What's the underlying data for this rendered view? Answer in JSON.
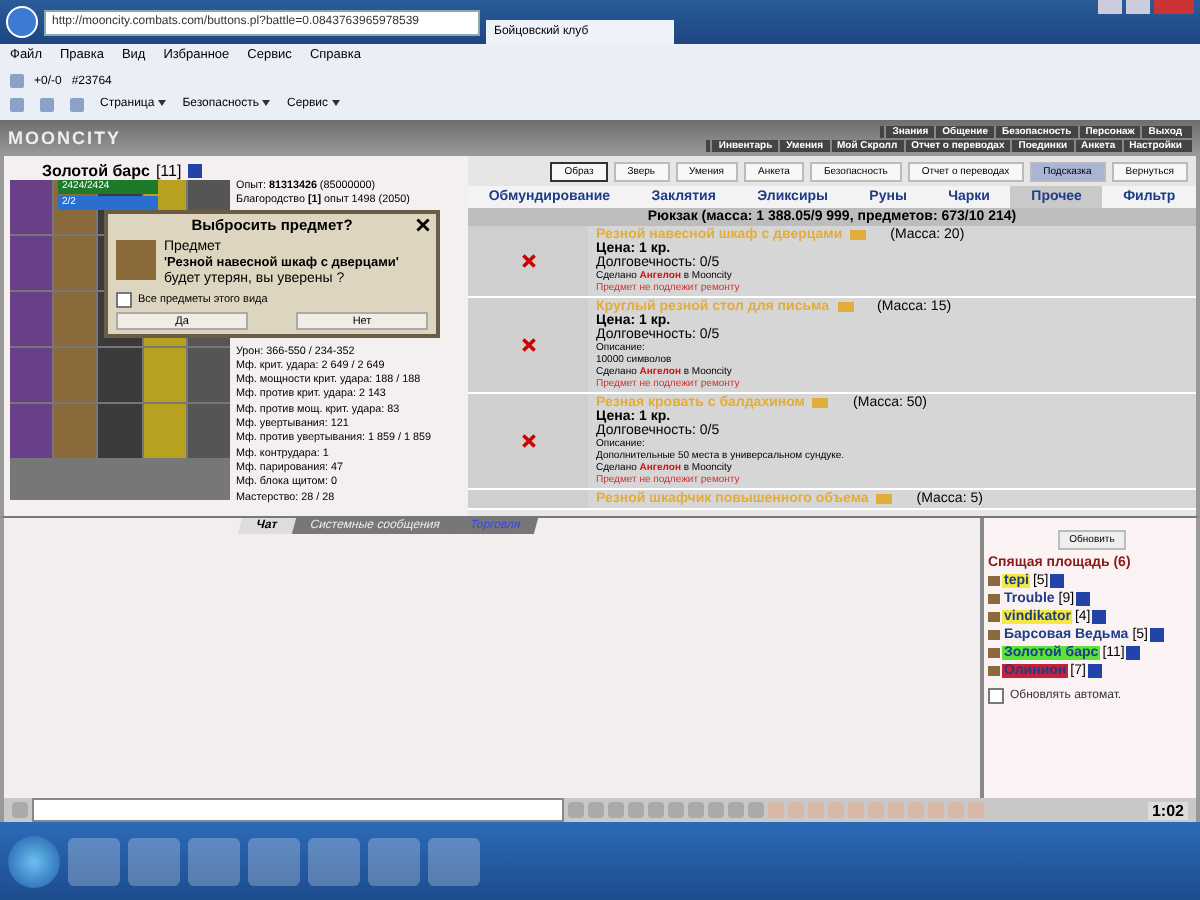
{
  "browser": {
    "url": "http://mooncity.combats.com/buttons.pl?battle=0.0843763965978539",
    "tab_title": "Бойцовский клуб",
    "menu": [
      "Файл",
      "Правка",
      "Вид",
      "Избранное",
      "Сервис",
      "Справка"
    ],
    "favorites": [
      "+0/-0",
      "#23764"
    ],
    "commands": [
      "Страница",
      "Безопасность",
      "Сервис"
    ]
  },
  "game": {
    "logo": "MOONCITY",
    "top_links": [
      "Знания",
      "Общение",
      "Безопасность",
      "Персонаж",
      "Выход"
    ],
    "sub_links": [
      "Инвентарь",
      "Умения",
      "Мой Скролл",
      "Отчет о переводах",
      "Поединки",
      "Анкета",
      "Настройки"
    ]
  },
  "character": {
    "name": "Золотой барс",
    "level": "[11]",
    "hp": {
      "text": "2424/2424",
      "level": 1
    },
    "mana": {
      "text": "2/2",
      "level": 1
    },
    "stats": [
      "Опыт: **81313426** (85000000)",
      "Благородство **[1]** опыт 1498 (2050)"
    ],
    "stats_lower": [
      "Урон: 366-550 / 234-352",
      "Мф. крит. удара: 2 649 / 2 649",
      "Мф. мощности крит. удара: 188 / 188",
      "Мф. против крит. удара: 2 143",
      "Мф. против мощ. крит. удара: 83",
      "Мф. увертывания: 121",
      "Мф. против увертывания: 1 859 / 1 859",
      "Мф. контрудара: 1",
      "Мф. парирования: 47",
      "Мф. блока щитом: 0",
      "Мастерство: 28 / 28"
    ]
  },
  "dialog": {
    "title": "Выбросить предмет?",
    "line_1": "Предмет",
    "item": "'Резной навесной шкаф с дверцами'",
    "line_2": "будет утерян, вы уверены ?",
    "all_of_kind": {
      "label": "Все предметы этого вида",
      "checked": false
    },
    "buttons": [
      "Да",
      "Нет"
    ]
  },
  "buttons": [
    {
      "label": "Образ",
      "highlighted": false,
      "framed": true
    },
    {
      "label": "Зверь",
      "highlighted": false,
      "framed": false
    },
    {
      "label": "Умения",
      "highlighted": false,
      "framed": false
    },
    {
      "label": "Анкета",
      "highlighted": false,
      "framed": false
    },
    {
      "label": "Безопасность",
      "highlighted": false,
      "framed": false
    },
    {
      "label": "Отчет о переводах",
      "highlighted": false,
      "framed": false
    },
    {
      "label": "Подсказка",
      "highlighted": true,
      "framed": false
    },
    {
      "label": "Вернуться",
      "highlighted": false,
      "framed": false
    }
  ],
  "tabs": [
    {
      "label": "Обмундирование",
      "selected": false
    },
    {
      "label": "Заклятия",
      "selected": false
    },
    {
      "label": "Эликсиры",
      "selected": false
    },
    {
      "label": "Руны",
      "selected": false
    },
    {
      "label": "Чарки",
      "selected": false
    },
    {
      "label": "Прочее",
      "selected": true
    },
    {
      "label": "Фильтр",
      "selected": false
    }
  ],
  "backpack_title": "Рюкзак (масса: 1 388.05/9 999, предметов: 673/10 214)",
  "items": [
    {
      "name": "Резной навесной шкаф с дверцами",
      "weight": "(Масса: 20)",
      "price": "Цена: 1 кр.",
      "durability": "Долговечность: 0/5",
      "maker": "Сделано **Ангелон** в Mooncity",
      "repair": "Предмет не подлежит ремонту"
    },
    {
      "name": "Круглый резной стол для письма",
      "weight": "(Масса: 15)",
      "price": "Цена: 1 кр.",
      "durability": "Долговечность: 0/5",
      "description_label": "Описание:",
      "description": "10000 символов",
      "maker": "Сделано **Ангелон** в Mooncity",
      "repair": "Предмет не подлежит ремонту"
    },
    {
      "name": "Резная кровать с балдахином",
      "weight": "(Масса: 50)",
      "price": "Цена: 1 кр.",
      "durability": "Долговечность: 0/5",
      "description_label": "Описание:",
      "description": "Дополнительные 50 места в универсальном сундуке.",
      "maker": "Сделано **Ангелон** в Mooncity",
      "repair": "Предмет не подлежит ремонту"
    },
    {
      "name": "Резной шкафчик повышенного объема",
      "weight": "(Масса: 5)"
    }
  ],
  "chat_tabs": [
    {
      "label": "Чат",
      "selected": true,
      "kind": "plain"
    },
    {
      "label": "Системные сообщения",
      "selected": false,
      "kind": "plain"
    },
    {
      "label": "Торговля",
      "selected": false,
      "kind": "link"
    }
  ],
  "online": {
    "refresh": "Обновить",
    "room": "Спящая площадь (6)",
    "users": [
      {
        "name": "tepi",
        "level": "[5]",
        "color": "#f4e842"
      },
      {
        "name": "Trouble",
        "level": "[9]"
      },
      {
        "name": "vindikator",
        "level": "[4]",
        "color": "#f4e842"
      },
      {
        "name": "Барсовая Ведьма",
        "level": "[5]"
      },
      {
        "name": "Золотой барс",
        "level": "[11]",
        "color": "#5be33a"
      },
      {
        "name": "Олинион",
        "level": "[7]",
        "color": "#c8203a"
      }
    ],
    "auto_refresh": {
      "label": "Обновлять автомат.",
      "checked": false
    }
  },
  "chat_clock": "1:02"
}
